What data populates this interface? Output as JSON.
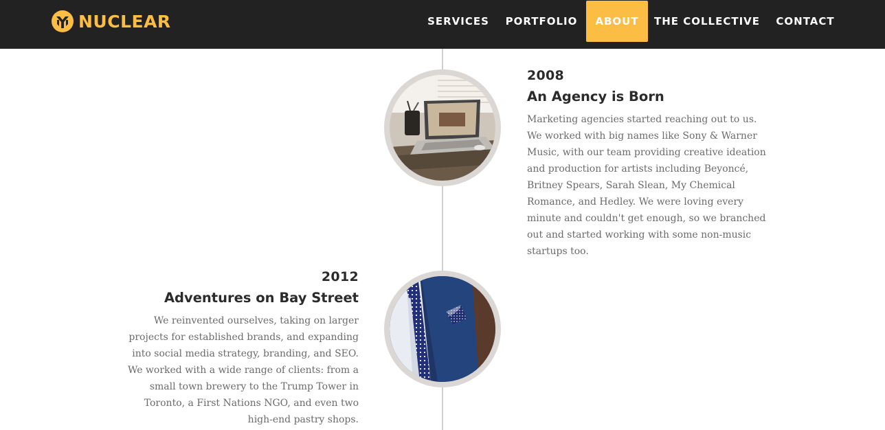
{
  "brand": {
    "name": "NUCLEAR",
    "accent": "#fbbd44",
    "nav_bg": "#222222"
  },
  "nav": {
    "services": "SERVICES",
    "portfolio": "PORTFOLIO",
    "about": "ABOUT",
    "collective": "THE COLLECTIVE",
    "contact": "CONTACT",
    "active_item": "ABOUT"
  },
  "timeline": [
    {
      "year": "2008",
      "title": "An Agency is Born",
      "text": "Marketing agencies started reaching out to us. We worked with big names like Sony & Warner Music, with our team providing creative ideation and production for artists including Beyoncé, Britney Spears, Sarah Slean, My Chemical Romance, and Hedley. We were loving every minute and couldn't get enough, so we branched out and started working with some non-music startups too.",
      "image": "laptop-on-desk-photo"
    },
    {
      "year": "2012",
      "title": "Adventures on Bay Street",
      "text": "We reinvented ourselves, taking on larger projects for established brands, and expanding into social media strategy, branding, and SEO. We worked with a wide range of clients: from a small town brewery to the Trump Tower in Toronto, a First Nations NGO, and even two high-end pastry shops.",
      "image": "suit-and-tie-photo"
    }
  ]
}
